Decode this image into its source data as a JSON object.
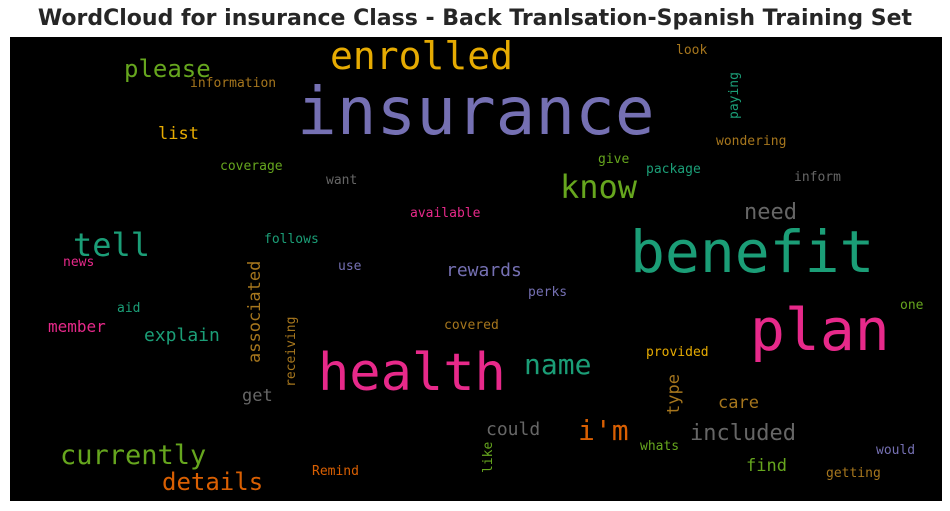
{
  "title": "WordCloud for insurance Class - Back Tranlsation-Spanish Training Set",
  "words": {
    "insurance": "insurance",
    "benefit": "benefit",
    "plan": "plan",
    "health": "health",
    "enrolled": "enrolled",
    "know": "know",
    "tell": "tell",
    "please": "please",
    "name": "name",
    "im": "i'm",
    "currently": "currently",
    "details": "details",
    "included": "included",
    "need": "need",
    "rewards": "rewards",
    "explain": "explain",
    "member": "member",
    "associated": "associated",
    "type": "type",
    "could": "could",
    "care": "care",
    "find": "find",
    "list": "list",
    "get": "get",
    "information": "information",
    "coverage": "coverage",
    "want": "want",
    "available": "available",
    "follows": "follows",
    "use": "use",
    "news": "news",
    "aid": "aid",
    "perks": "perks",
    "covered": "covered",
    "receiving": "receiving",
    "provided": "provided",
    "whats": "whats",
    "like": "like",
    "remind": "Remind",
    "getting": "getting",
    "would": "would",
    "one": "one",
    "give": "give",
    "package": "package",
    "inform": "inform",
    "wondering": "wondering",
    "paying": "paying",
    "look": "look"
  },
  "colors": {
    "purple": "#7570b3",
    "teal": "#1b9e77",
    "pink": "#e7298a",
    "orange": "#d95f02",
    "olive": "#66a61e",
    "gold": "#e6ab02",
    "brown": "#a6761d",
    "gray": "#666666"
  }
}
